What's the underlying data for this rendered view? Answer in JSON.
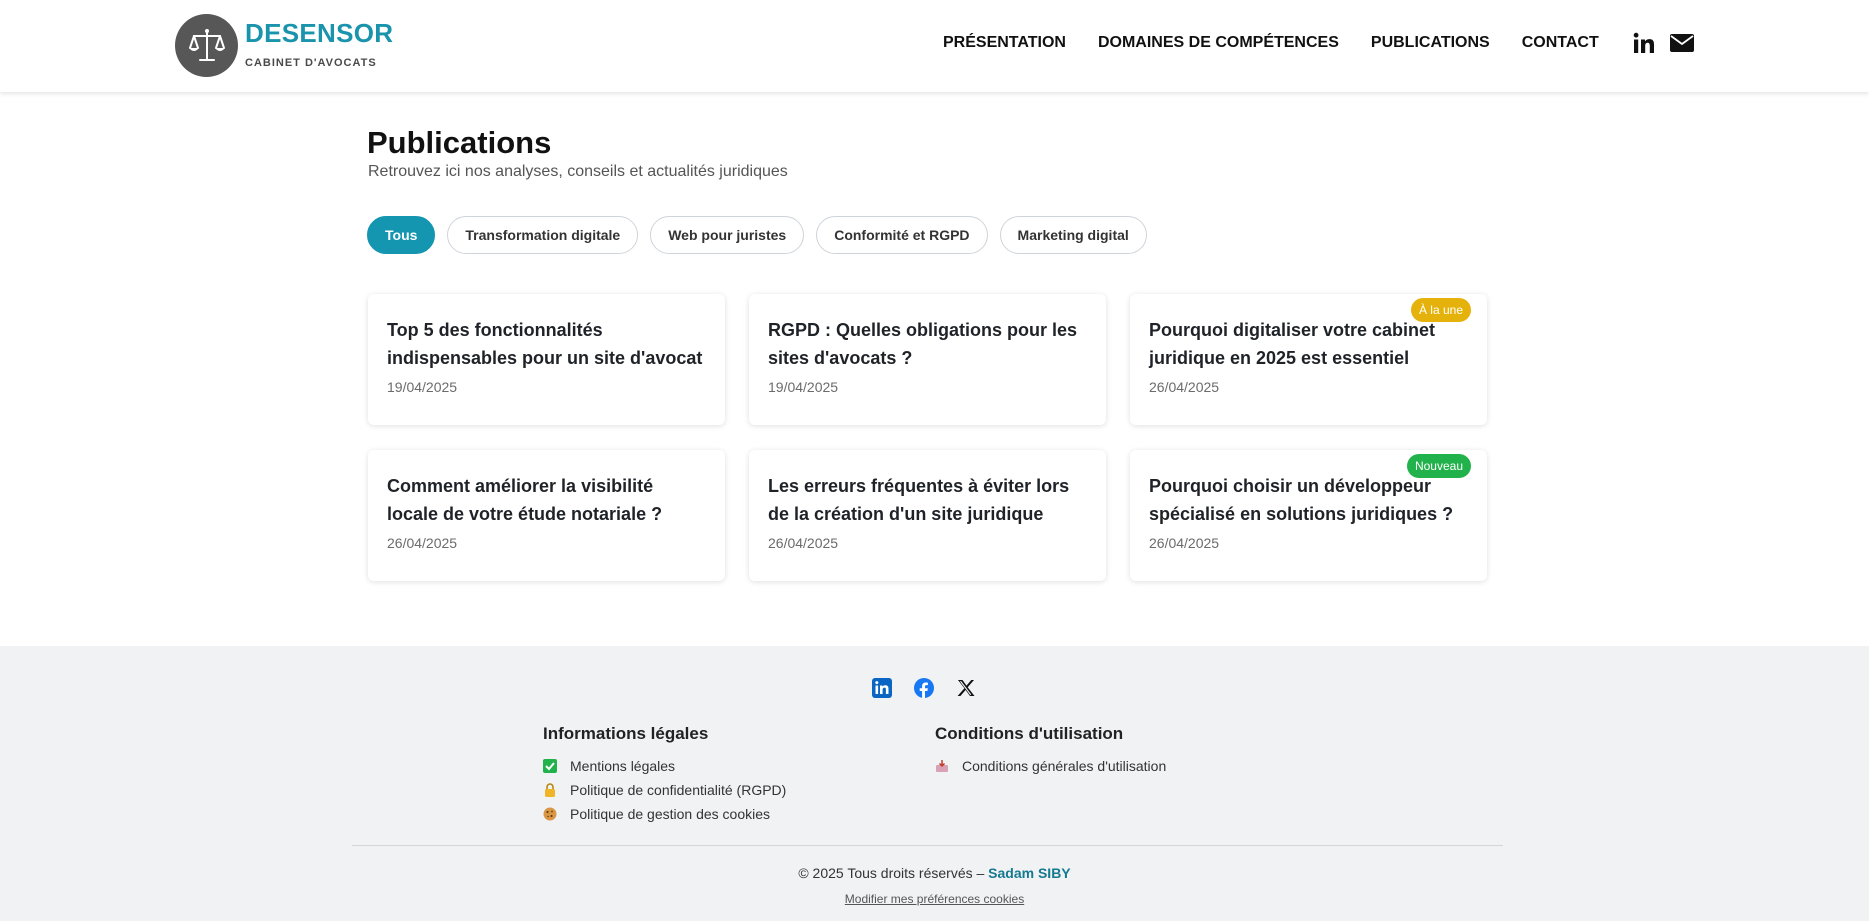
{
  "brand": {
    "name": "DESENSOR",
    "tagline": "CABINET D'AVOCATS",
    "logo_icon": "scales-of-justice-icon",
    "accent_color": "#1a94ad",
    "logo_bg": "#575757"
  },
  "nav": {
    "items": [
      {
        "label": "PRÉSENTATION"
      },
      {
        "label": "DOMAINES DE COMPÉTENCES"
      },
      {
        "label": "PUBLICATIONS"
      },
      {
        "label": "CONTACT"
      }
    ],
    "icons": [
      "linkedin-icon",
      "envelope-icon"
    ]
  },
  "main": {
    "title": "Publications",
    "subtitle": "Retrouvez ici nos analyses, conseils et actualités juridiques",
    "filters": [
      {
        "label": "Tous",
        "active": true
      },
      {
        "label": "Transformation digitale",
        "active": false
      },
      {
        "label": "Web pour juristes",
        "active": false
      },
      {
        "label": "Conformité et RGPD",
        "active": false
      },
      {
        "label": "Marketing digital",
        "active": false
      }
    ],
    "articles": [
      {
        "title": "Top 5 des fonctionnalités indispensables pour un site d'avocat",
        "date": "19/04/2025",
        "badge": ""
      },
      {
        "title": "RGPD : Quelles obligations pour les sites d'avocats ?",
        "date": "19/04/2025",
        "badge": ""
      },
      {
        "title": "Pourquoi digitaliser votre cabinet juridique en 2025 est essentiel",
        "date": "26/04/2025",
        "badge": "À la une"
      },
      {
        "title": "Comment améliorer la visibilité locale de votre étude notariale ?",
        "date": "26/04/2025",
        "badge": ""
      },
      {
        "title": "Les erreurs fréquentes à éviter lors de la création d'un site juridique",
        "date": "26/04/2025",
        "badge": ""
      },
      {
        "title": "Pourquoi choisir un développeur spécialisé en solutions juridiques ?",
        "date": "26/04/2025",
        "badge": "Nouveau"
      }
    ],
    "colors": {
      "active_filter": "#1496b0",
      "badge_featured": "#e5b20c",
      "badge_new": "#22b24c"
    }
  },
  "footer": {
    "social_icons": [
      "linkedin-icon",
      "facebook-icon",
      "x-icon"
    ],
    "legal": {
      "heading": "Informations légales",
      "links": [
        {
          "label": "Mentions légales",
          "icon": "check-box-icon"
        },
        {
          "label": "Politique de confidentialité (RGPD)",
          "icon": "lock-icon"
        },
        {
          "label": "Politique de gestion des cookies",
          "icon": "cookie-icon"
        }
      ]
    },
    "terms": {
      "heading": "Conditions d'utilisation",
      "links": [
        {
          "label": "Conditions générales d'utilisation",
          "icon": "inbox-tray-icon"
        }
      ]
    },
    "copyright_prefix": "© 2025 Tous droits réservés – ",
    "copyright_author": "Sadam SIBY",
    "cookie_prefs_label": "Modifier mes préférences cookies"
  }
}
